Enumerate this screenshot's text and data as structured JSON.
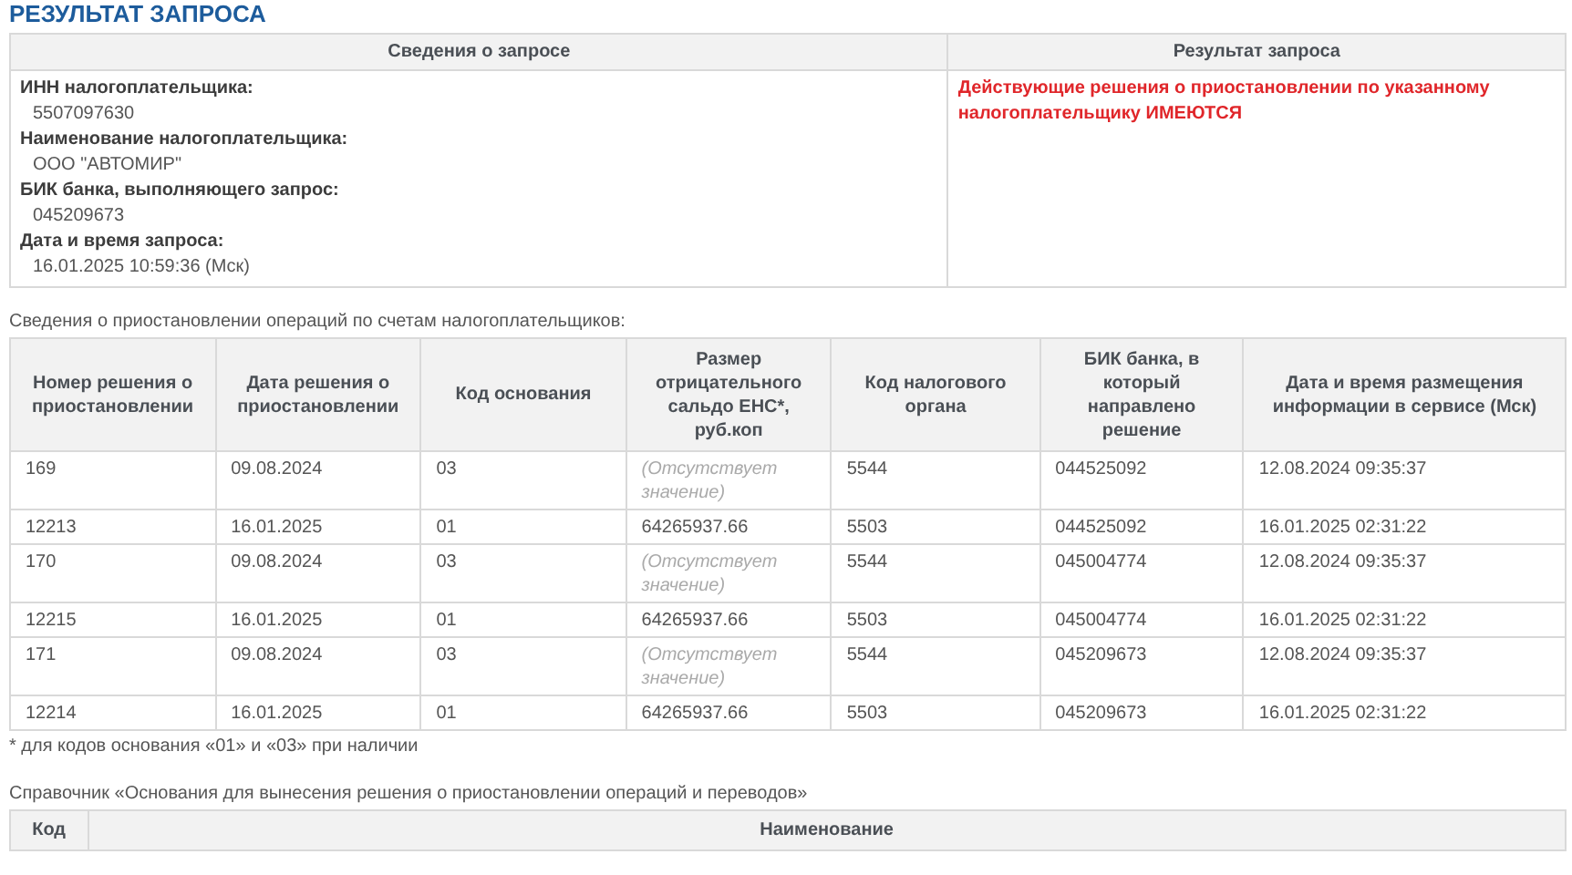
{
  "title": "РЕЗУЛЬТАТ ЗАПРОСА",
  "request": {
    "columns": [
      "Сведения о запросе",
      "Результат запроса"
    ],
    "info": [
      {
        "label": "ИНН налогоплательщика:",
        "value": "5507097630"
      },
      {
        "label": "Наименование налогоплательщика:",
        "value": "ООО \"АВТОМИР\""
      },
      {
        "label": "БИК банка, выполняющего запрос:",
        "value": "045209673"
      },
      {
        "label": "Дата и время запроса:",
        "value": "16.01.2025 10:59:36 (Мск)"
      }
    ],
    "result": "Действующие решения о приостановлении по указанному налогоплательщику ИМЕЮТСЯ"
  },
  "suspensions": {
    "caption": "Сведения о приостановлении операций по счетам налогоплательщиков:",
    "columns": [
      "Номер решения о приостановлении",
      "Дата решения о приостановлении",
      "Код основания",
      "Размер отрицательного сальдо ЕНС*, руб.коп",
      "Код налогового органа",
      "БИК банка, в который направлено решение",
      "Дата и время размещения информации в сервисе (Мск)"
    ],
    "rows": [
      {
        "number": "169",
        "date": "09.08.2024",
        "code": "03",
        "balance": {
          "text": "(Отсутствует значение)",
          "missing": true
        },
        "authority": "5544",
        "bik": "044525092",
        "posted": "12.08.2024 09:35:37"
      },
      {
        "number": "12213",
        "date": "16.01.2025",
        "code": "01",
        "balance": {
          "text": "64265937.66",
          "missing": false
        },
        "authority": "5503",
        "bik": "044525092",
        "posted": "16.01.2025 02:31:22"
      },
      {
        "number": "170",
        "date": "09.08.2024",
        "code": "03",
        "balance": {
          "text": "(Отсутствует значение)",
          "missing": true
        },
        "authority": "5544",
        "bik": "045004774",
        "posted": "12.08.2024 09:35:37"
      },
      {
        "number": "12215",
        "date": "16.01.2025",
        "code": "01",
        "balance": {
          "text": "64265937.66",
          "missing": false
        },
        "authority": "5503",
        "bik": "045004774",
        "posted": "16.01.2025 02:31:22"
      },
      {
        "number": "171",
        "date": "09.08.2024",
        "code": "03",
        "balance": {
          "text": "(Отсутствует значение)",
          "missing": true
        },
        "authority": "5544",
        "bik": "045209673",
        "posted": "12.08.2024 09:35:37"
      },
      {
        "number": "12214",
        "date": "16.01.2025",
        "code": "01",
        "balance": {
          "text": "64265937.66",
          "missing": false
        },
        "authority": "5503",
        "bik": "045209673",
        "posted": "16.01.2025 02:31:22"
      }
    ],
    "footnote": "* для кодов основания «01» и «03» при наличии"
  },
  "reference": {
    "caption": "Справочник «Основания для вынесения решения о приостановлении операций и переводов»",
    "columns": [
      "Код",
      "Наименование"
    ]
  }
}
